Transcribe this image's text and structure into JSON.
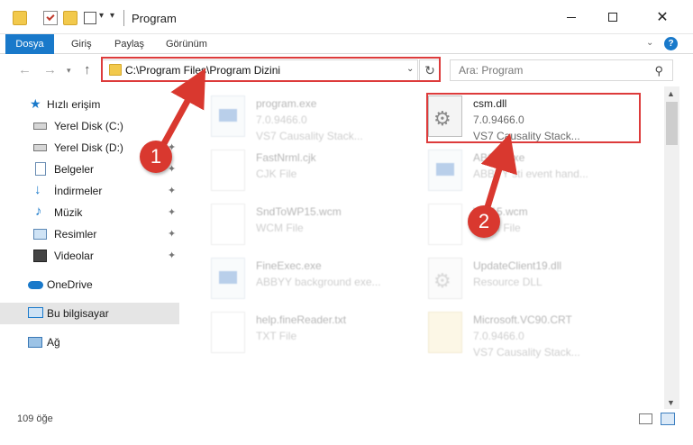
{
  "window": {
    "title": "Program",
    "minimize_icon": "minimize-icon",
    "maximize_icon": "maximize-icon",
    "close_glyph": "✕"
  },
  "ribbon": {
    "tabs": [
      "Dosya",
      "Giriş",
      "Paylaş",
      "Görünüm"
    ],
    "help_glyph": "?",
    "accent_color": "#1979ca"
  },
  "address_bar": {
    "path": "C:\\Program Files\\Program Dizini",
    "refresh_glyph": "↻"
  },
  "search": {
    "placeholder": "Ara: Program",
    "icon_glyph": "⚲"
  },
  "nav_pane": {
    "items": [
      {
        "label": "Hızlı erişim",
        "icon": "star-icon",
        "pinned": false
      },
      {
        "label": "Yerel Disk (C:)",
        "icon": "drive-icon",
        "pinned": true
      },
      {
        "label": "Yerel Disk (D:)",
        "icon": "drive-icon",
        "pinned": true
      },
      {
        "label": "Belgeler",
        "icon": "documents-icon",
        "pinned": true
      },
      {
        "label": "İndirmeler",
        "icon": "download-icon",
        "pinned": true
      },
      {
        "label": "Müzik",
        "icon": "music-icon",
        "pinned": true
      },
      {
        "label": "Resimler",
        "icon": "pictures-icon",
        "pinned": true
      },
      {
        "label": "Videolar",
        "icon": "videos-icon",
        "pinned": true
      },
      {
        "label": "OneDrive",
        "icon": "cloud-icon",
        "pinned": false
      },
      {
        "label": "Bu bilgisayar",
        "icon": "computer-icon",
        "pinned": false,
        "selected": true
      },
      {
        "label": "Ağ",
        "icon": "network-icon",
        "pinned": false
      }
    ],
    "pin_glyph": "📌"
  },
  "files": [
    {
      "name": "program.exe",
      "line2": "7.0.9466.0",
      "line3": "VS7 Causality Stack...",
      "icon": "exe-icon",
      "faded": true
    },
    {
      "name": "csm.dll",
      "line2": "7.0.9466.0",
      "line3": "VS7 Causality Stack...",
      "icon": "dll-icon",
      "faded": false,
      "highlighted": true
    },
    {
      "name": "FastNrml.cjk",
      "line2": "CJK File",
      "line3": "",
      "icon": "document-icon",
      "faded": true
    },
    {
      "name": "ABSTI.exe",
      "line2": "ABBYY sti event hand...",
      "line3": "",
      "icon": "exe-icon",
      "faded": true
    },
    {
      "name": "SndToWP15.wcm",
      "line2": "WCM File",
      "line3": "",
      "icon": "document-icon",
      "faded": true
    },
    {
      "name": "WP15.wcm",
      "line2": "WCM File",
      "line3": "",
      "icon": "document-icon",
      "faded": true
    },
    {
      "name": "FineExec.exe",
      "line2": "ABBYY background exe...",
      "line3": "",
      "icon": "exe-icon",
      "faded": true
    },
    {
      "name": "UpdateClient19.dll",
      "line2": "Resource DLL",
      "line3": "",
      "icon": "dll-icon",
      "faded": true
    },
    {
      "name": "help.fineReader.txt",
      "line2": "TXT File",
      "line3": "",
      "icon": "document-icon",
      "faded": true
    },
    {
      "name": "Microsoft.VC90.CRT",
      "line2": "7.0.9466.0",
      "line3": "VS7 Causality Stack...",
      "icon": "manifest-icon",
      "faded": true
    }
  ],
  "status": {
    "item_count": "109 öğe"
  },
  "annotations": {
    "step1": "1",
    "step2": "2",
    "color": "#d9382f"
  }
}
